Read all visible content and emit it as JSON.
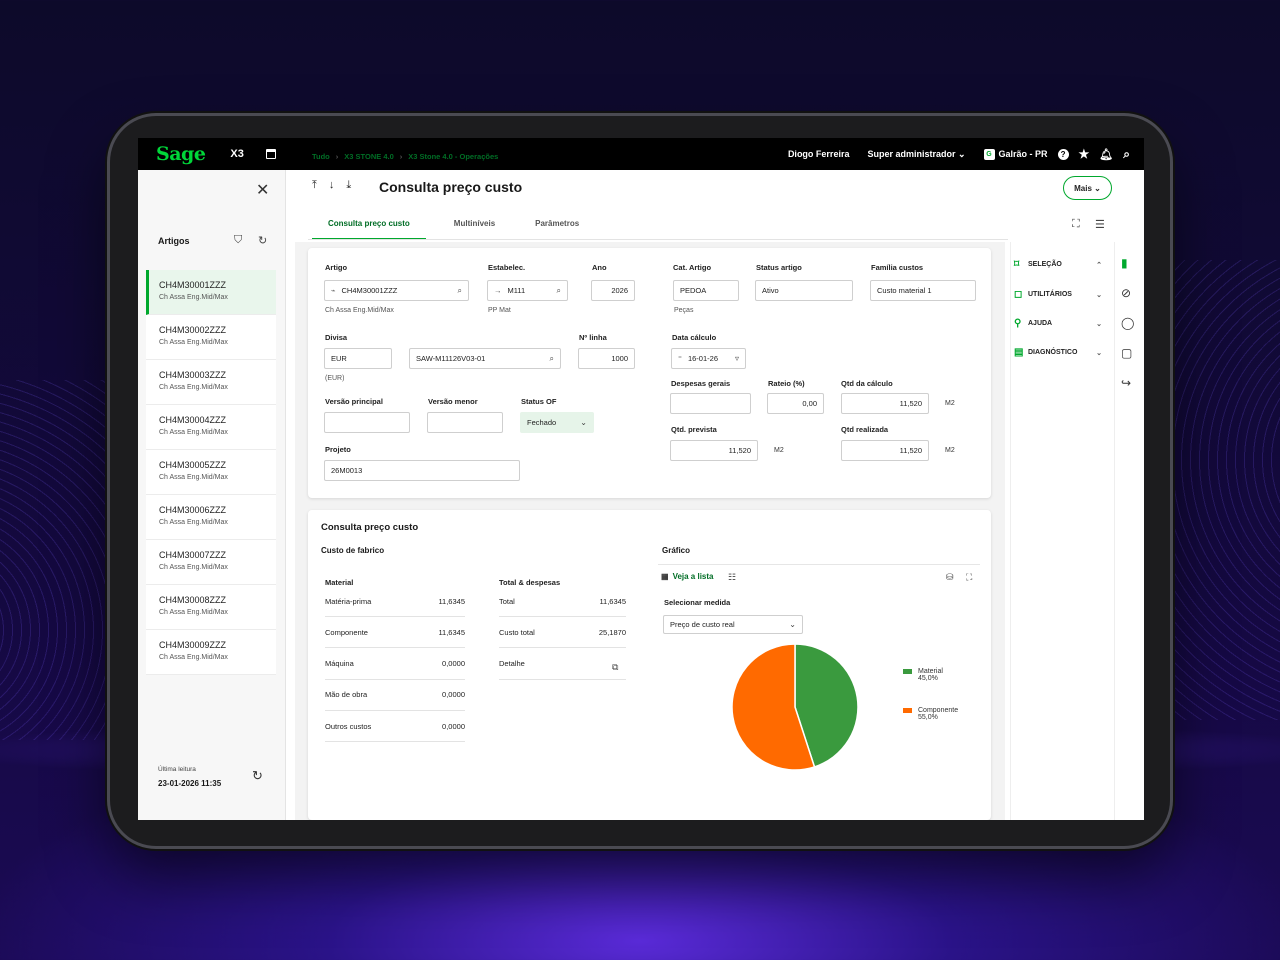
{
  "topbar": {
    "logo": "Sage",
    "product": "X3",
    "user": "Diogo Ferreira",
    "role": "Super administrador ⌄",
    "site_badge": "G",
    "site": "Galrão - PR",
    "help": "?"
  },
  "left_panel": {
    "title": "Artigos",
    "items": [
      {
        "code": "CH4M30001ZZZ",
        "desc": "Ch Assa Eng.Mid/Max"
      },
      {
        "code": "CH4M30002ZZZ",
        "desc": "Ch Assa Eng.Mid/Max"
      },
      {
        "code": "CH4M30003ZZZ",
        "desc": "Ch Assa Eng.Mid/Max"
      },
      {
        "code": "CH4M30004ZZZ",
        "desc": "Ch Assa Eng.Mid/Max"
      },
      {
        "code": "CH4M30005ZZZ",
        "desc": "Ch Assa Eng.Mid/Max"
      },
      {
        "code": "CH4M30006ZZZ",
        "desc": "Ch Assa Eng.Mid/Max"
      },
      {
        "code": "CH4M30007ZZZ",
        "desc": "Ch Assa Eng.Mid/Max"
      },
      {
        "code": "CH4M30008ZZZ",
        "desc": "Ch Assa Eng.Mid/Max"
      },
      {
        "code": "CH4M30009ZZZ",
        "desc": "Ch Assa Eng.Mid/Max"
      }
    ],
    "last_read_label": "Última leitura",
    "last_read": "23-01-2026 11:35"
  },
  "breadcrumb": [
    "Tudo",
    "X3 STONE 4.0",
    "X3 Stone 4.0 - Operações"
  ],
  "page": {
    "title": "Consulta preço custo",
    "more": "Mais ⌄"
  },
  "tabs": [
    "Consulta preço custo",
    "Multiníveis",
    "Parâmetros"
  ],
  "form": {
    "artigo_label": "Artigo",
    "artigo": "CH4M30001ZZZ",
    "artigo_desc": "Ch Assa Eng.Mid/Max",
    "estab_label": "Estabelec.",
    "estab": "M111",
    "estab_desc": "PP Mat",
    "ano_label": "Ano",
    "ano": "2026",
    "cat_label": "Cat. Artigo",
    "cat": "PEDOA",
    "cat_desc": "Peças",
    "status_label": "Status artigo",
    "status": "Ativo",
    "familia_label": "Família custos",
    "familia": "Custo material 1",
    "divisa_label": "Divisa",
    "divisa": "EUR",
    "divisa_desc": "(EUR)",
    "route": "SAW-M11126V03-01",
    "linha_label": "Nº linha",
    "linha": "1000",
    "data_label": "Data cálculo",
    "data": "16-01-26",
    "desp_label": "Despesas gerais",
    "rateio_label": "Rateio (%)",
    "rateio": "0,00",
    "qtdcalc_label": "Qtd da cálculo",
    "qtdcalc": "11,520",
    "unit": "M2",
    "vp_label": "Versão principal",
    "vm_label": "Versão menor",
    "statusof_label": "Status OF",
    "statusof": "Fechado",
    "qtdprev_label": "Qtd. prevista",
    "qtdprev": "11,520",
    "qtdreal_label": "Qtd realizada",
    "qtdreal": "11,520",
    "projeto_label": "Projeto",
    "projeto": "26M0013"
  },
  "cost": {
    "title": "Consulta preço custo",
    "fab": "Custo de fabrico",
    "grafico": "Gráfico",
    "mat_h": "Material",
    "tot_h": "Total & despesas",
    "mat_rows": [
      {
        "k": "Matéria-prima",
        "v": "11,6345"
      },
      {
        "k": "Componente",
        "v": "11,6345"
      },
      {
        "k": "Máquina",
        "v": "0,0000"
      },
      {
        "k": "Mão de obra",
        "v": "0,0000"
      },
      {
        "k": "Outros custos",
        "v": "0,0000"
      }
    ],
    "tot_rows": [
      {
        "k": "Total",
        "v": "11,6345"
      },
      {
        "k": "Custo total",
        "v": "25,1870"
      },
      {
        "k": "Detalhe",
        "v": ""
      }
    ],
    "veja": "Veja a lista",
    "medida_label": "Selecionar medida",
    "medida": "Preço de custo real"
  },
  "chart_data": {
    "type": "pie",
    "categories": [
      "Material",
      "Componente"
    ],
    "values": [
      45.0,
      55.0
    ],
    "labels": [
      "45,0%",
      "55,0%"
    ],
    "colors": [
      "#3a9a3e",
      "#ff6a00"
    ]
  },
  "right_panel": [
    "SELEÇÃO",
    "UTILITÁRIOS",
    "AJUDA",
    "DIAGNÓSTICO"
  ]
}
